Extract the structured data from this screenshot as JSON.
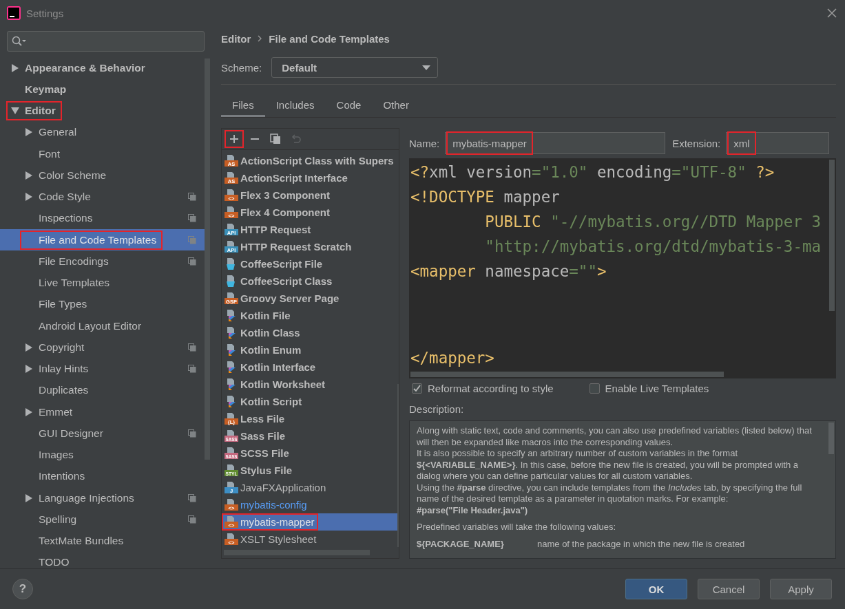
{
  "window": {
    "title": "Settings"
  },
  "sidebar": {
    "items": [
      {
        "label": "Appearance & Behavior",
        "kind": "group",
        "expanded": false,
        "selected": false,
        "scoped": false,
        "annotated": false
      },
      {
        "label": "Keymap",
        "kind": "leaf",
        "selected": false,
        "scoped": false,
        "annotated": false
      },
      {
        "label": "Editor",
        "kind": "group",
        "expanded": true,
        "selected": false,
        "scoped": false,
        "annotated": true,
        "children": [
          {
            "label": "General",
            "kind": "group",
            "expanded": false,
            "selected": false,
            "scoped": false,
            "annotated": false
          },
          {
            "label": "Font",
            "kind": "leaf",
            "selected": false,
            "scoped": false,
            "annotated": false
          },
          {
            "label": "Color Scheme",
            "kind": "group",
            "expanded": false,
            "selected": false,
            "scoped": false,
            "annotated": false
          },
          {
            "label": "Code Style",
            "kind": "group",
            "expanded": false,
            "selected": false,
            "scoped": true,
            "annotated": false
          },
          {
            "label": "Inspections",
            "kind": "leaf",
            "selected": false,
            "scoped": true,
            "annotated": false
          },
          {
            "label": "File and Code Templates",
            "kind": "leaf",
            "selected": true,
            "scoped": true,
            "annotated": true
          },
          {
            "label": "File Encodings",
            "kind": "leaf",
            "selected": false,
            "scoped": true,
            "annotated": false
          },
          {
            "label": "Live Templates",
            "kind": "leaf",
            "selected": false,
            "scoped": false,
            "annotated": false
          },
          {
            "label": "File Types",
            "kind": "leaf",
            "selected": false,
            "scoped": false,
            "annotated": false
          },
          {
            "label": "Android Layout Editor",
            "kind": "leaf",
            "selected": false,
            "scoped": false,
            "annotated": false
          },
          {
            "label": "Copyright",
            "kind": "group",
            "expanded": false,
            "selected": false,
            "scoped": true,
            "annotated": false
          },
          {
            "label": "Inlay Hints",
            "kind": "group",
            "expanded": false,
            "selected": false,
            "scoped": true,
            "annotated": false
          },
          {
            "label": "Duplicates",
            "kind": "leaf",
            "selected": false,
            "scoped": false,
            "annotated": false
          },
          {
            "label": "Emmet",
            "kind": "group",
            "expanded": false,
            "selected": false,
            "scoped": false,
            "annotated": false
          },
          {
            "label": "GUI Designer",
            "kind": "leaf",
            "selected": false,
            "scoped": true,
            "annotated": false
          },
          {
            "label": "Images",
            "kind": "leaf",
            "selected": false,
            "scoped": false,
            "annotated": false
          },
          {
            "label": "Intentions",
            "kind": "leaf",
            "selected": false,
            "scoped": false,
            "annotated": false
          },
          {
            "label": "Language Injections",
            "kind": "group",
            "expanded": false,
            "selected": false,
            "scoped": true,
            "annotated": false
          },
          {
            "label": "Spelling",
            "kind": "leaf",
            "selected": false,
            "scoped": true,
            "annotated": false
          },
          {
            "label": "TextMate Bundles",
            "kind": "leaf",
            "selected": false,
            "scoped": false,
            "annotated": false
          },
          {
            "label": "TODO",
            "kind": "leaf",
            "selected": false,
            "scoped": false,
            "annotated": false
          }
        ]
      }
    ]
  },
  "breadcrumb": [
    "Editor",
    "File and Code Templates"
  ],
  "scheme": {
    "label": "Scheme:",
    "value": "Default"
  },
  "tabs": [
    {
      "label": "Files",
      "selected": true
    },
    {
      "label": "Includes",
      "selected": false
    },
    {
      "label": "Code",
      "selected": false
    },
    {
      "label": "Other",
      "selected": false
    }
  ],
  "template_toolbar": [
    {
      "kind": "plus",
      "disabled": false,
      "annotated": true
    },
    {
      "kind": "minus",
      "disabled": false,
      "annotated": false
    },
    {
      "kind": "copy",
      "disabled": false,
      "annotated": false
    },
    {
      "kind": "revert",
      "disabled": true,
      "annotated": false
    }
  ],
  "templates": [
    {
      "name": "ActionScript Class with Supers",
      "kind": "bold",
      "selected": false,
      "annotated": false,
      "icon": {
        "kind": "badge",
        "badge": "AS",
        "color": "#c75e24"
      }
    },
    {
      "name": "ActionScript Interface",
      "kind": "bold",
      "selected": false,
      "annotated": false,
      "icon": {
        "kind": "badge",
        "badge": "AS",
        "color": "#c75e24"
      }
    },
    {
      "name": "Flex 3 Component",
      "kind": "bold",
      "selected": false,
      "annotated": false,
      "icon": {
        "kind": "badge",
        "badge": "<>",
        "color": "#c75e24"
      }
    },
    {
      "name": "Flex 4 Component",
      "kind": "bold",
      "selected": false,
      "annotated": false,
      "icon": {
        "kind": "badge",
        "badge": "<>",
        "color": "#c75e24"
      }
    },
    {
      "name": "HTTP Request",
      "kind": "bold",
      "selected": false,
      "annotated": false,
      "icon": {
        "kind": "badge",
        "badge": "API",
        "color": "#3a8fb8"
      }
    },
    {
      "name": "HTTP Request Scratch",
      "kind": "bold",
      "selected": false,
      "annotated": false,
      "icon": {
        "kind": "badge",
        "badge": "API",
        "color": "#3a8fb8"
      }
    },
    {
      "name": "CoffeeScript File",
      "kind": "bold",
      "selected": false,
      "annotated": false,
      "icon": {
        "kind": "cup"
      }
    },
    {
      "name": "CoffeeScript Class",
      "kind": "bold",
      "selected": false,
      "annotated": false,
      "icon": {
        "kind": "cup"
      }
    },
    {
      "name": "Groovy Server Page",
      "kind": "bold",
      "selected": false,
      "annotated": false,
      "icon": {
        "kind": "badge",
        "badge": "GSP",
        "color": "#c75e24"
      }
    },
    {
      "name": "Kotlin File",
      "kind": "bold",
      "selected": false,
      "annotated": false,
      "icon": {
        "kind": "triangle"
      }
    },
    {
      "name": "Kotlin Class",
      "kind": "bold",
      "selected": false,
      "annotated": false,
      "icon": {
        "kind": "triangle"
      }
    },
    {
      "name": "Kotlin Enum",
      "kind": "bold",
      "selected": false,
      "annotated": false,
      "icon": {
        "kind": "triangle"
      }
    },
    {
      "name": "Kotlin Interface",
      "kind": "bold",
      "selected": false,
      "annotated": false,
      "icon": {
        "kind": "triangle"
      }
    },
    {
      "name": "Kotlin Worksheet",
      "kind": "bold",
      "selected": false,
      "annotated": false,
      "icon": {
        "kind": "triangle"
      }
    },
    {
      "name": "Kotlin Script",
      "kind": "bold",
      "selected": false,
      "annotated": false,
      "icon": {
        "kind": "triangle"
      }
    },
    {
      "name": "Less File",
      "kind": "bold",
      "selected": false,
      "annotated": false,
      "icon": {
        "kind": "badge",
        "badge": "{L}",
        "color": "#c75e24"
      }
    },
    {
      "name": "Sass File",
      "kind": "bold",
      "selected": false,
      "annotated": false,
      "icon": {
        "kind": "badge",
        "badge": "SASS",
        "color": "#c4687e"
      }
    },
    {
      "name": "SCSS File",
      "kind": "bold",
      "selected": false,
      "annotated": false,
      "icon": {
        "kind": "badge",
        "badge": "SASS",
        "color": "#c4687e"
      }
    },
    {
      "name": "Stylus File",
      "kind": "bold",
      "selected": false,
      "annotated": false,
      "icon": {
        "kind": "badge",
        "badge": "STYL",
        "color": "#5f8b2f"
      }
    },
    {
      "name": "JavaFXApplication",
      "kind": "plain",
      "selected": false,
      "annotated": false,
      "icon": {
        "kind": "badge",
        "badge": "J",
        "color": "#3d8ec4"
      }
    },
    {
      "name": "mybatis-config",
      "kind": "changed",
      "selected": false,
      "annotated": false,
      "icon": {
        "kind": "badge",
        "badge": "<>",
        "color": "#c75e24"
      }
    },
    {
      "name": "mybatis-mapper",
      "kind": "plain",
      "selected": true,
      "annotated": true,
      "icon": {
        "kind": "badge",
        "badge": "<>",
        "color": "#c75e24"
      }
    },
    {
      "name": "XSLT Stylesheet",
      "kind": "plain",
      "selected": false,
      "annotated": false,
      "icon": {
        "kind": "badge",
        "badge": "<>",
        "color": "#c75e24"
      }
    }
  ],
  "name_field": {
    "label": "Name:",
    "value": "mybatis-mapper",
    "annotated": true
  },
  "extension_field": {
    "label": "Extension:",
    "value": "xml",
    "annotated": true
  },
  "code_lines": [
    {
      "kind": "line",
      "tokens": [
        {
          "t": "<?",
          "kind": "tag"
        },
        {
          "t": "xml version",
          "kind": "name"
        },
        {
          "t": "=\"1.0\"",
          "kind": "value"
        },
        {
          "t": " encoding",
          "kind": "name"
        },
        {
          "t": "=\"UTF-8\"",
          "kind": "value"
        },
        {
          "t": " ?>",
          "kind": "tag"
        }
      ]
    },
    {
      "kind": "line",
      "tokens": [
        {
          "t": "<!DOCTYPE",
          "kind": "tag"
        },
        {
          "t": " mapper",
          "kind": "name"
        }
      ]
    },
    {
      "kind": "line",
      "tokens": [
        {
          "t": "        PUBLIC",
          "kind": "tag"
        },
        {
          "t": " \"-//mybatis.org//DTD Mapper 3",
          "kind": "value"
        }
      ]
    },
    {
      "kind": "line",
      "tokens": [
        {
          "t": "        \"http://mybatis.org/dtd/mybatis-3-ma",
          "kind": "value"
        }
      ]
    },
    {
      "kind": "line",
      "tokens": [
        {
          "t": "<mapper",
          "kind": "tag"
        },
        {
          "t": " namespace",
          "kind": "name"
        },
        {
          "t": "=\"\"",
          "kind": "value"
        },
        {
          "t": ">",
          "kind": "tag"
        }
      ]
    },
    {
      "kind": "end",
      "tokens": [
        {
          "t": "</mapper>",
          "kind": "tag"
        }
      ]
    }
  ],
  "options": [
    {
      "label": "Reformat according to style",
      "checked": true
    },
    {
      "label": "Enable Live Templates",
      "checked": false
    }
  ],
  "description": {
    "label": "Description:",
    "paragraphs": [
      {
        "kind": "text",
        "text": "Along with static text, code and comments, you can also use predefined variables (listed below) that will then be expanded like macros into the corresponding values."
      },
      {
        "kind": "text",
        "text": "It is also possible to specify an arbitrary number of custom variables in the format **${<VARIABLE_NAME>}**. In this case, before the new file is created, you will be prompted with a dialog where you can define particular values for all custom variables."
      },
      {
        "kind": "text",
        "text": "Using the **#parse** directive, you can include templates from the *Includes* tab, by specifying the full name of the desired template as a parameter in quotation marks. For example:"
      },
      {
        "kind": "text",
        "text": "**#parse(\"File Header.java\")**"
      },
      {
        "kind": "section",
        "text": "Predefined variables will take the following values:"
      }
    ],
    "variables": [
      {
        "name": "${PACKAGE_NAME}",
        "text": "name of the package in which the new file is created"
      }
    ]
  },
  "help": "?",
  "buttons": [
    {
      "label": "OK",
      "default": true
    },
    {
      "label": "Cancel",
      "default": false
    },
    {
      "label": "Apply",
      "default": false
    }
  ]
}
